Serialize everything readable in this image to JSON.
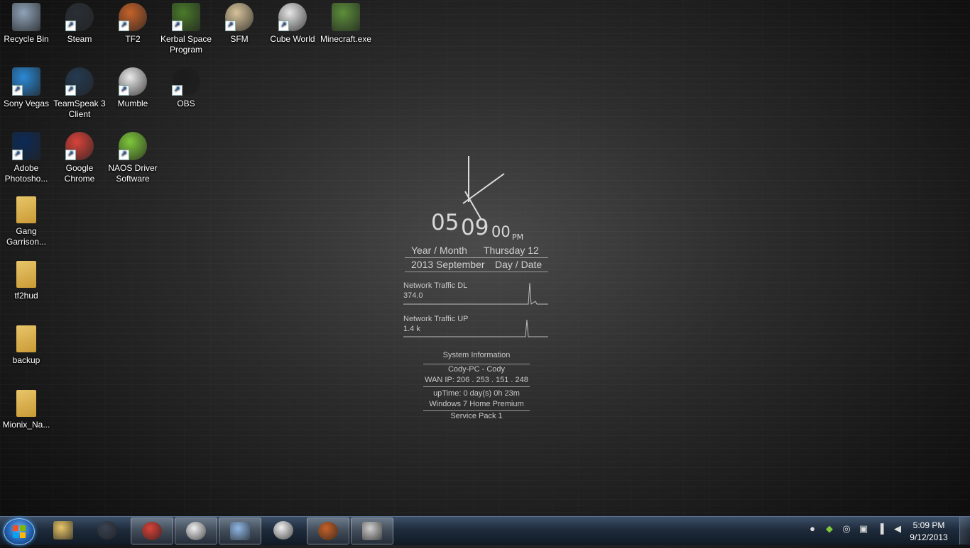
{
  "desktop": {
    "icons": [
      {
        "label": "Recycle Bin",
        "icon": "recycle-bin-icon",
        "color": "#8fa3b8"
      },
      {
        "label": "Steam",
        "icon": "steam-icon",
        "color": "#2a2f36"
      },
      {
        "label": "TF2",
        "icon": "tf2-icon",
        "color": "#c5622a"
      },
      {
        "label": "Kerbal Space Program",
        "icon": "kerbal-icon",
        "color": "#4a7a2a"
      },
      {
        "label": "SFM",
        "icon": "sfm-icon",
        "color": "#d7c39a"
      },
      {
        "label": "Cube World",
        "icon": "cube-world-icon",
        "color": "#e6e6e6"
      },
      {
        "label": "Minecraft.exe",
        "icon": "minecraft-icon",
        "color": "#5c8e3a"
      },
      {
        "label": "Sony Vegas",
        "icon": "sony-vegas-icon",
        "color": "#2b8ad8"
      },
      {
        "label": "TeamSpeak 3 Client",
        "icon": "teamspeak-icon",
        "color": "#243a52"
      },
      {
        "label": "Mumble",
        "icon": "mumble-icon",
        "color": "#eaeaea"
      },
      {
        "label": "OBS",
        "icon": "obs-icon",
        "color": "#1b1b1b"
      },
      {
        "label": "Adobe Photosho...",
        "icon": "photoshop-icon",
        "color": "#0c2a57"
      },
      {
        "label": "Google Chrome",
        "icon": "chrome-icon",
        "color": "#d8433a"
      },
      {
        "label": "NAOS Driver Software",
        "icon": "naos-icon",
        "color": "#7ec83a"
      },
      {
        "label": "Gang Garrison...",
        "icon": "folder-icon",
        "color": "#e8c66a"
      },
      {
        "label": "tf2hud",
        "icon": "folder-icon",
        "color": "#e8c66a"
      },
      {
        "label": "backup",
        "icon": "folder-icon",
        "color": "#e8c66a"
      },
      {
        "label": "Mionix_Na...",
        "icon": "folder-icon",
        "color": "#e8c66a"
      }
    ]
  },
  "widget": {
    "hour": "05",
    "minute": "09",
    "second": "00",
    "ampm": "PM",
    "year_month_label": "Year / Month",
    "weekday_day": "Thursday 12",
    "year_month": "2013 September",
    "day_date_label": "Day / Date",
    "net_dl_label": "Network Traffic DL",
    "net_dl_value": "374.0",
    "net_up_label": "Network Traffic UP",
    "net_up_value": "1.4 k",
    "sys_title": "System Information",
    "sys_user": "Cody-PC - Cody",
    "sys_ip": "WAN IP: 206 . 253 . 151 . 248",
    "sys_uptime": "upTime: 0 day(s) 0h 23m",
    "sys_os": "Windows 7 Home Premium",
    "sys_sp": "Service Pack 1"
  },
  "taskbar": {
    "items": [
      {
        "icon": "explorer-folder-icon",
        "color": "#e8c66a",
        "active": false
      },
      {
        "icon": "steam-icon",
        "color": "#3a4352",
        "active": false
      },
      {
        "icon": "chrome-icon",
        "color": "#d8433a",
        "active": true
      },
      {
        "icon": "foobar-icon",
        "color": "#f0f0f0",
        "active": true
      },
      {
        "icon": "notepad-icon",
        "color": "#8fb8e6",
        "active": true
      },
      {
        "icon": "mumble-icon",
        "color": "#f0f0f0",
        "active": false
      },
      {
        "icon": "tf2-icon",
        "color": "#c5622a",
        "active": true
      },
      {
        "icon": "server-icon",
        "color": "#cfcfcf",
        "active": true
      }
    ],
    "tray_icons": [
      "water-drop-icon",
      "naos-tray-icon",
      "steam-tray-icon",
      "usb-icon",
      "network-signal-icon",
      "volume-muted-icon"
    ],
    "time": "5:09 PM",
    "date": "9/12/2013"
  }
}
